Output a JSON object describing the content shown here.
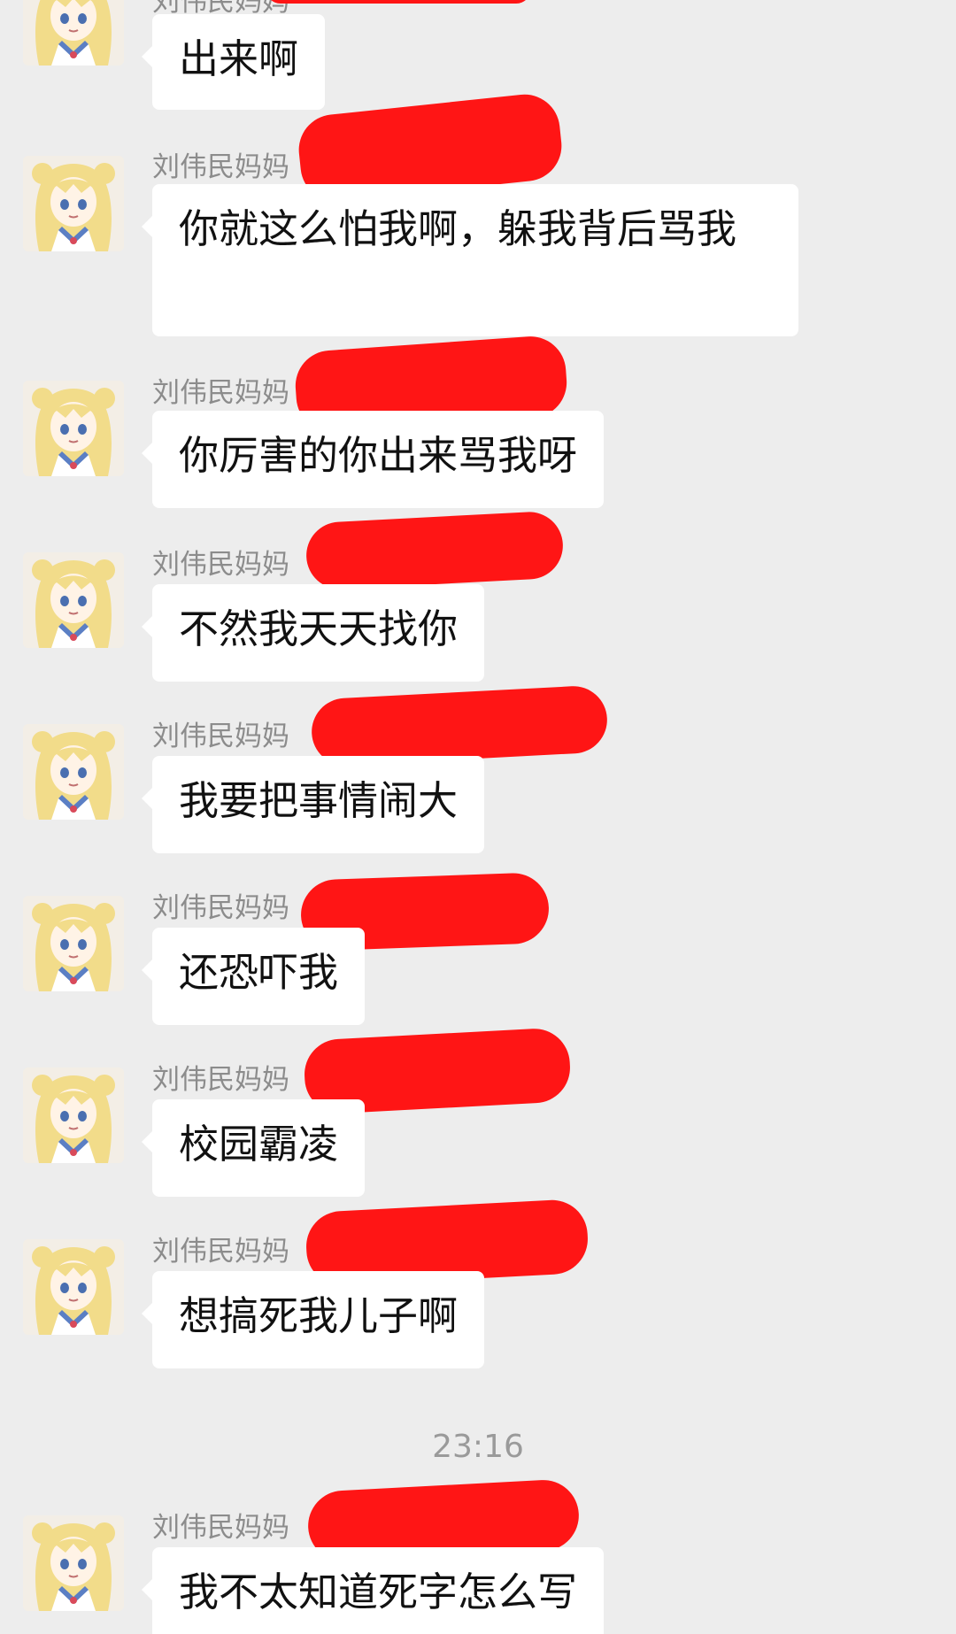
{
  "sender_name": "刘伟民妈妈",
  "timestamp": "23:16",
  "messages": [
    {
      "text": "出来啊"
    },
    {
      "text": "你就这么怕我啊，躲我背后骂我"
    },
    {
      "text": "你厉害的你出来骂我呀"
    },
    {
      "text": "不然我天天找你"
    },
    {
      "text": "我要把事情闹大"
    },
    {
      "text": "还恐吓我"
    },
    {
      "text": "校园霸凌"
    },
    {
      "text": "想搞死我儿子啊"
    },
    {
      "text": "我不太知道死字怎么写"
    }
  ],
  "colors": {
    "background": "#ededed",
    "bubble": "#ffffff",
    "redaction": "#ff1515",
    "sender_text": "#8c8c8c"
  },
  "icons": {
    "avatar": "anime-girl-avatar-icon"
  }
}
